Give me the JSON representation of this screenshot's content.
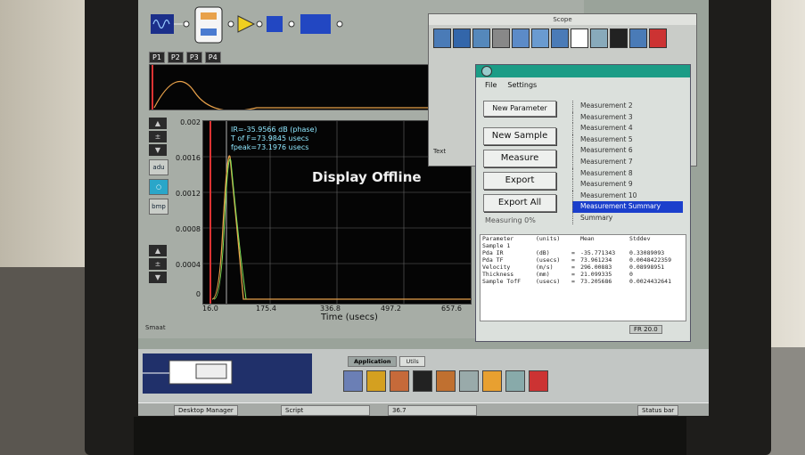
{
  "app": {
    "probe_tabs": [
      "P1",
      "P2",
      "P3",
      "P4"
    ],
    "plot": {
      "y_ticks": [
        "0.002",
        "0.0016",
        "0.0012",
        "0.0008",
        "0.0004",
        "0"
      ],
      "x_ticks": [
        "16.0",
        "175.4",
        "336.8",
        "497.2",
        "657.6"
      ],
      "x_label": "Time (usecs)",
      "overlay_text": "Display Offline",
      "readout": [
        "IR=-35.9566 dB (phase)",
        "T of F=73.9845 usecs",
        "fpeak=73.1976 usecs"
      ]
    },
    "side_tools": [
      "adu",
      "bmp"
    ],
    "status_left": "Smaat"
  },
  "scope": {
    "title": "Scope",
    "text_label": "Text"
  },
  "settings": {
    "menu": [
      "File",
      "Settings"
    ],
    "buttons": {
      "new_parameter": "New Parameter",
      "new_sample": "New Sample",
      "measure": "Measure",
      "export": "Export",
      "export_all": "Export All"
    },
    "measurements": [
      "Measurement 2",
      "Measurement 3",
      "Measurement 4",
      "Measurement 5",
      "Measurement 6",
      "Measurement 7",
      "Measurement 8",
      "Measurement 9",
      "Measurement 10",
      "Measurement Summary",
      "Summary"
    ],
    "selected_index": 9,
    "measuring_label": "Measuring 0%",
    "results_header": [
      "Parameter",
      "(units)",
      "",
      "Mean",
      "Stddev"
    ],
    "sample_label": "Sample 1",
    "results_rows": [
      [
        "Pda IR",
        "(dB)",
        "=",
        "-35.771343",
        "0.33089093"
      ],
      [
        "Pda TF",
        "(usecs)",
        "=",
        "73.961234",
        "0.0048422359"
      ],
      [
        "Velocity",
        "(m/s)",
        "=",
        "296.00883",
        "0.08998951"
      ],
      [
        "Thickness",
        "(mm)",
        "=",
        "21.099335",
        "0"
      ],
      [
        "Sample TofF",
        "(usecs)",
        "=",
        "73.205686",
        "0.0024432641"
      ]
    ],
    "fr_label": "FR",
    "fr_value": "20.0"
  },
  "dock": {
    "tabs": [
      "Application",
      "Utils"
    ],
    "active_tab": 0
  },
  "taskbar": {
    "items": [
      "Desktop Manager",
      "Script",
      "36.7",
      "Status bar"
    ]
  },
  "colors": {
    "plot_orange": "#e8a14a",
    "plot_green": "#7ee35a",
    "accent_teal": "#1b9c86",
    "selection_blue": "#1b3fcc"
  }
}
